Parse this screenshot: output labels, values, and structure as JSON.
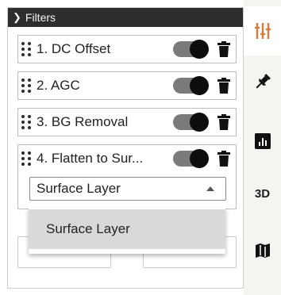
{
  "panel": {
    "title": "Filters",
    "filters": [
      {
        "label": "1. DC Offset",
        "enabled": true
      },
      {
        "label": "2. AGC",
        "enabled": true
      },
      {
        "label": "3. BG Removal",
        "enabled": true
      },
      {
        "label": "4. Flatten to Sur...",
        "enabled": true
      }
    ],
    "layer_select": {
      "value": "Surface Layer"
    },
    "dropdown_options": [
      "Surface Layer"
    ]
  },
  "toolbar": {
    "tools": [
      {
        "icon": "sliders-icon",
        "active": true
      },
      {
        "icon": "pin-icon",
        "active": false
      },
      {
        "icon": "chart-icon",
        "active": false
      },
      {
        "label": "3D",
        "active": false
      },
      {
        "icon": "map-icon",
        "active": false
      }
    ]
  },
  "colors": {
    "header_bg": "#2e2e2e",
    "accent": "#d9793a",
    "toggle_track": "#7a7a7a"
  }
}
